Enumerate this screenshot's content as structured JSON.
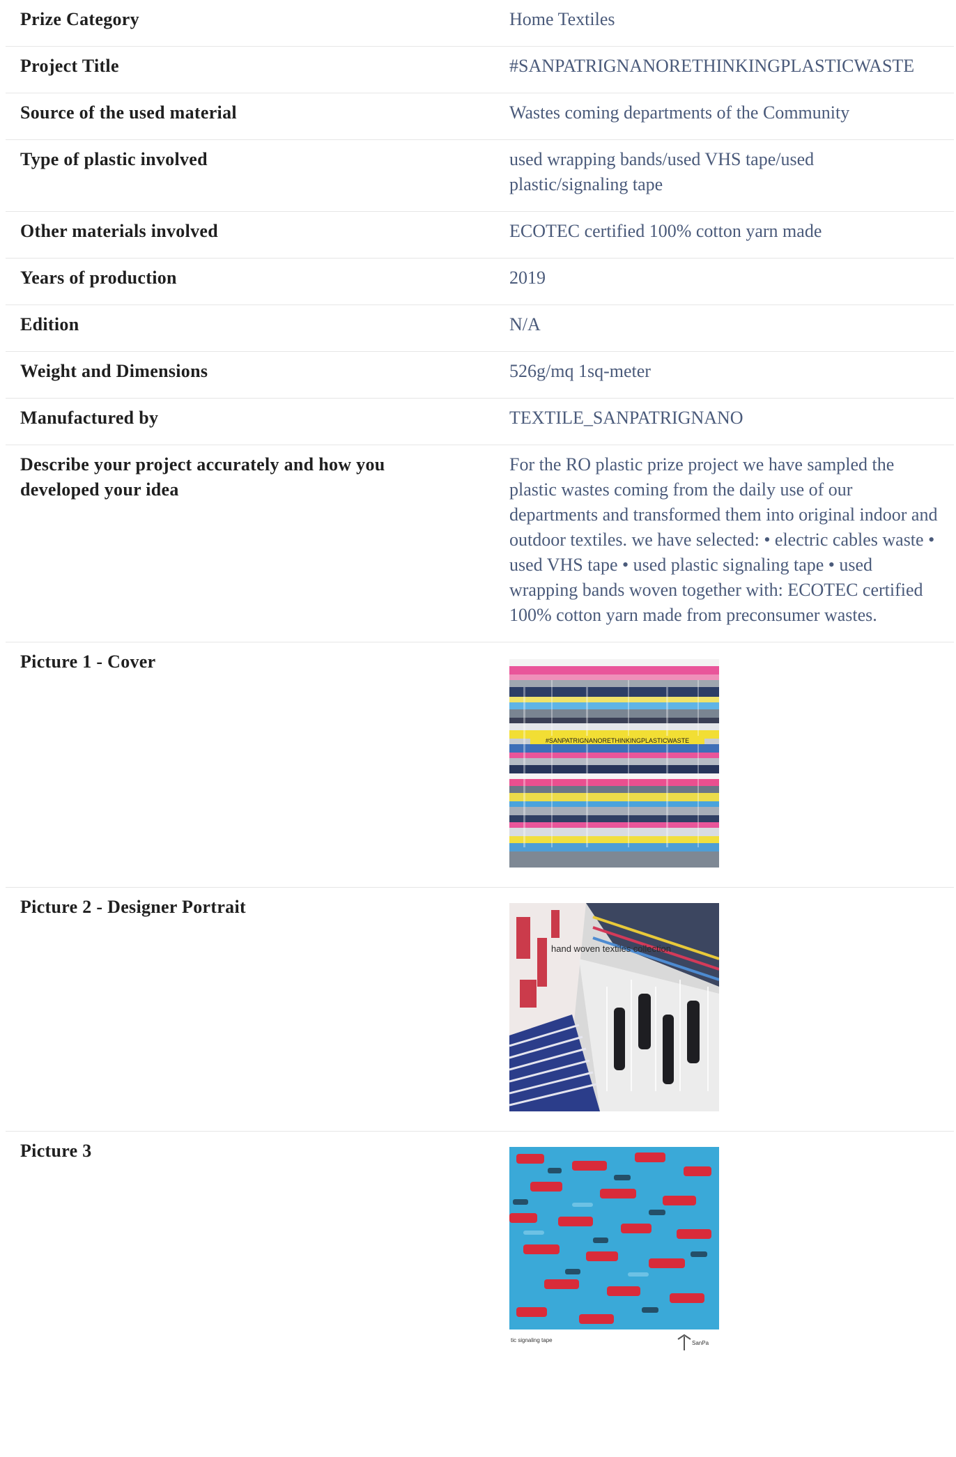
{
  "rows": [
    {
      "label": "Prize Category",
      "value": "Home Textiles"
    },
    {
      "label": "Project Title",
      "value": "#SANPATRIGNANORETHINKINGPLASTICWASTE"
    },
    {
      "label": "Source of the used material",
      "value": "Wastes coming departments of the Community"
    },
    {
      "label": "Type of plastic involved",
      "value": "used wrapping bands/used VHS tape/used plastic/signaling tape"
    },
    {
      "label": "Other materials involved",
      "value": "ECOTEC certified 100% cotton yarn made"
    },
    {
      "label": "Years of production",
      "value": "2019"
    },
    {
      "label": "Edition",
      "value": "N/A"
    },
    {
      "label": "Weight and Dimensions",
      "value": "526g/mq 1sq-meter"
    },
    {
      "label": "Manufactured by",
      "value": "TEXTILE_SANPATRIGNANO"
    },
    {
      "label": "Describe your project accurately and how you developed your idea",
      "value": "For the RO plastic prize project we have sampled the plastic wastes coming from the daily use of our departments and transformed them into original indoor and outdoor textiles. we have selected: • electric cables waste • used VHS tape • used plastic signaling tape • used wrapping bands woven together with: ECOTEC certified 100% cotton yarn made from preconsumer wastes."
    }
  ],
  "pictures": [
    {
      "label": "Picture 1 - Cover",
      "caption": "#SANPATRIGNANORETHINKINGPLASTICWASTE"
    },
    {
      "label": "Picture 2 - Designer Portrait",
      "caption": "hand woven textiles collection"
    },
    {
      "label": "Picture 3",
      "caption": "tic signaling tape",
      "logo": "SanPa"
    }
  ],
  "colors": {
    "label_text": "#1f1f1f",
    "value_text": "#4a5a7a",
    "divider": "#e6e6e6"
  }
}
